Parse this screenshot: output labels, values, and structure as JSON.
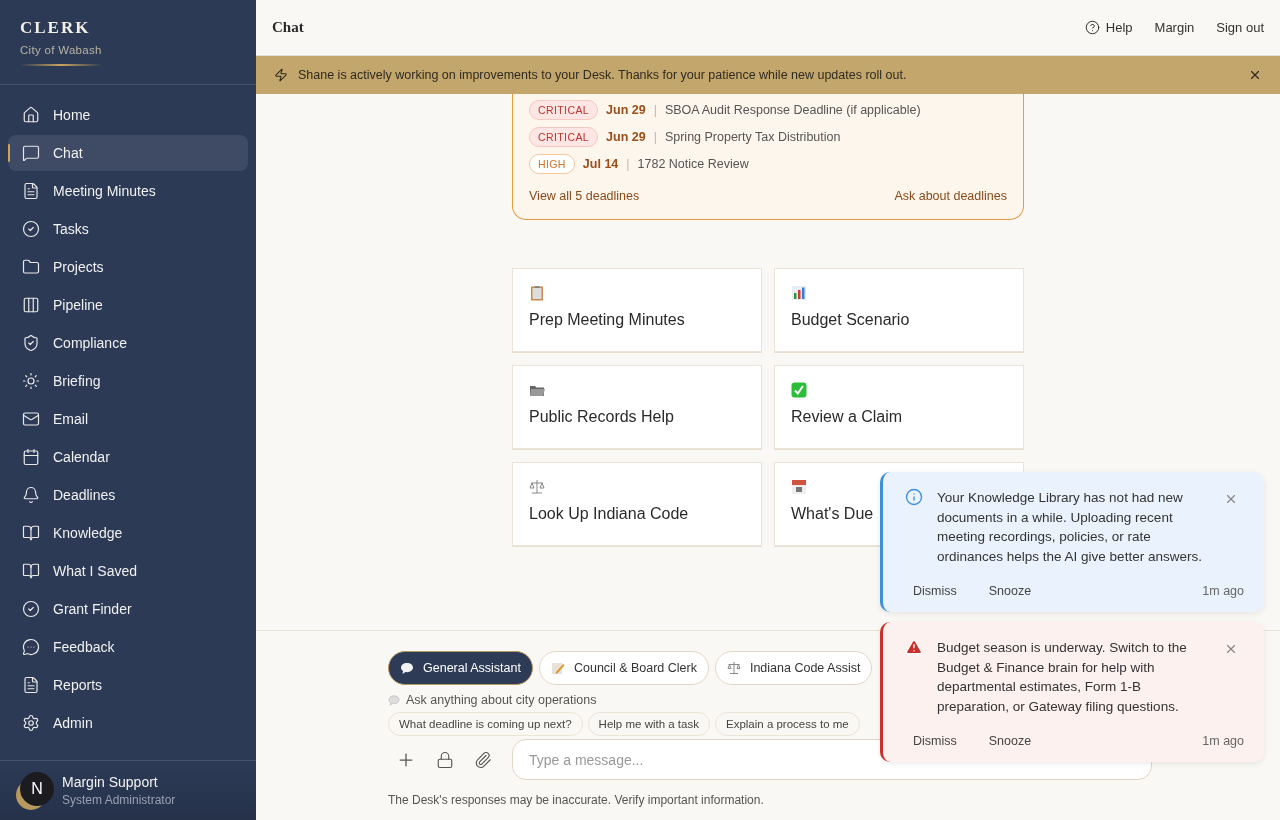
{
  "brand": {
    "title": "CLERK",
    "subtitle": "City of Wabash"
  },
  "sidebar": {
    "items": [
      {
        "label": "Home",
        "selected": false
      },
      {
        "label": "Chat",
        "selected": true
      },
      {
        "label": "Meeting Minutes",
        "selected": false
      },
      {
        "label": "Tasks",
        "selected": false
      },
      {
        "label": "Projects",
        "selected": false
      },
      {
        "label": "Pipeline",
        "selected": false
      },
      {
        "label": "Compliance",
        "selected": false
      },
      {
        "label": "Briefing",
        "selected": false
      },
      {
        "label": "Email",
        "selected": false
      },
      {
        "label": "Calendar",
        "selected": false
      },
      {
        "label": "Deadlines",
        "selected": false
      },
      {
        "label": "Knowledge",
        "selected": false
      },
      {
        "label": "What I Saved",
        "selected": false
      },
      {
        "label": "Grant Finder",
        "selected": false
      },
      {
        "label": "Feedback",
        "selected": false
      },
      {
        "label": "Reports",
        "selected": false
      },
      {
        "label": "Admin",
        "selected": false
      }
    ]
  },
  "user": {
    "initial": "N",
    "name": "Margin Support",
    "role": "System Administrator"
  },
  "header": {
    "title": "Chat",
    "links": [
      "Help",
      "Margin",
      "Sign out"
    ]
  },
  "banner": {
    "text": "Shane is actively working on improvements to your Desk. Thanks for your patience while new updates roll out."
  },
  "deadlines": {
    "items": [
      {
        "priority": "CRITICAL",
        "kind": "critical",
        "date": "Jun 29",
        "title": "SBOA Audit Response Deadline (if applicable)"
      },
      {
        "priority": "CRITICAL",
        "kind": "critical",
        "date": "Jun 29",
        "title": "Spring Property Tax Distribution"
      },
      {
        "priority": "HIGH",
        "kind": "high",
        "date": "Jul 14",
        "title": "1782 Notice Review"
      }
    ],
    "separator": "|",
    "view_all": "View all 5 deadlines",
    "ask": "Ask about deadlines"
  },
  "quick_actions": [
    {
      "label": "Prep Meeting Minutes"
    },
    {
      "label": "Budget Scenario"
    },
    {
      "label": "Public Records Help"
    },
    {
      "label": "Review a Claim"
    },
    {
      "label": "Look Up Indiana Code"
    },
    {
      "label": "What's Due"
    }
  ],
  "composer": {
    "assistants": [
      {
        "label": "General Assistant",
        "selected": true
      },
      {
        "label": "Council & Board Clerk",
        "selected": false
      },
      {
        "label": "Indiana Code Assist",
        "selected": false
      }
    ],
    "hint": "Ask anything about city operations",
    "suggestions": [
      "What deadline is coming up next?",
      "Help me with a task",
      "Explain a process to me"
    ],
    "placeholder": "Type a message...",
    "disclaimer": "The Desk's responses may be inaccurate. Verify important information."
  },
  "notifications": [
    {
      "kind": "info",
      "text": "Your Knowledge Library has not had new documents in a while. Uploading recent meeting recordings, policies, or rate ordinances helps the AI give better answers.",
      "actions": [
        "Dismiss",
        "Snooze"
      ],
      "time": "1m ago"
    },
    {
      "kind": "warning",
      "text": "Budget season is underway. Switch to the Budget & Finance brain for help with departmental estimates, Form 1-B preparation, or Gateway filing questions.",
      "actions": [
        "Dismiss",
        "Snooze"
      ],
      "time": "1m ago"
    }
  ]
}
